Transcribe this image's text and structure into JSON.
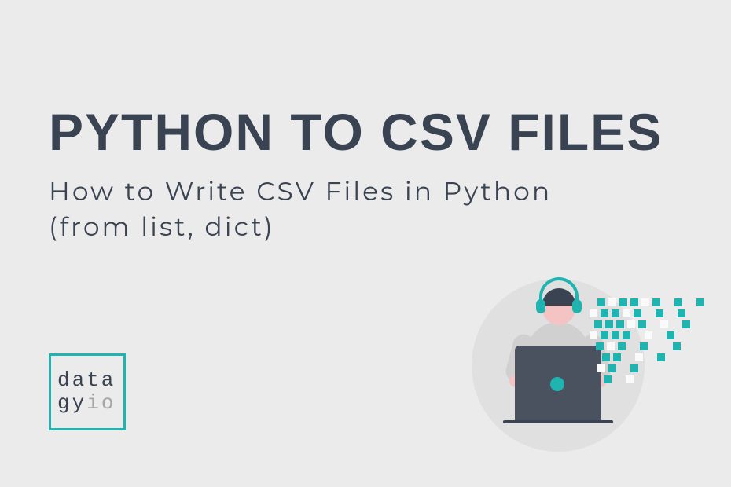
{
  "title": "PYTHON TO CSV FILES",
  "subtitle_line1": "How to Write CSV Files in Python",
  "subtitle_line2": "(from list, dict)",
  "logo": {
    "line1": "data",
    "line2_main": "gy",
    "line2_io": "io"
  },
  "colors": {
    "background": "#ebebeb",
    "text": "#3a4352",
    "accent": "#1fb4b0",
    "muted": "#a5a5a5"
  }
}
